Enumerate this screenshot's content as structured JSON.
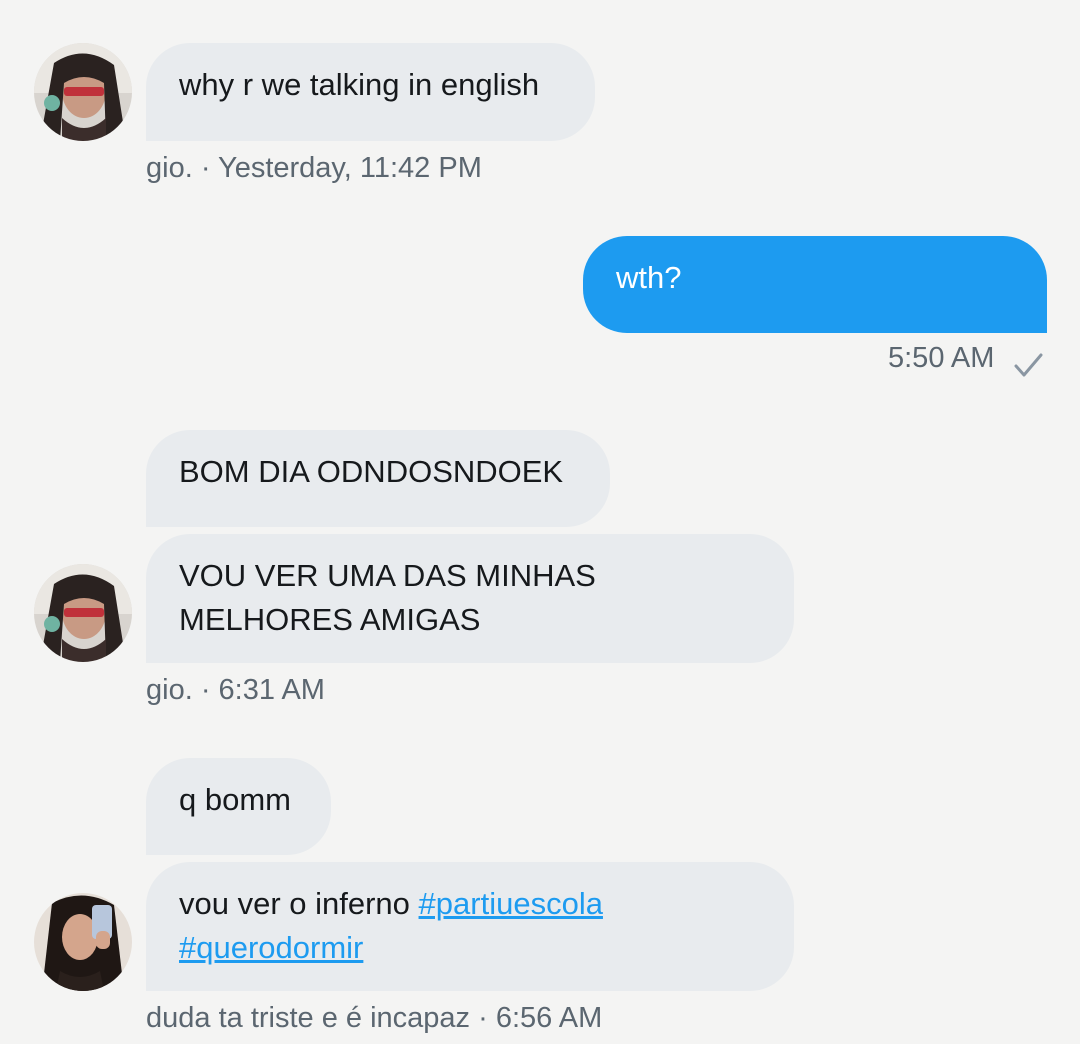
{
  "conversation": {
    "group1": {
      "messages": [
        "why r we talking in english"
      ],
      "sender": "gio.",
      "time": "Yesterday, 11:42 PM"
    },
    "group2": {
      "messages": [
        "wth?"
      ],
      "time": "5:50 AM",
      "status_icon": "checkmark-icon"
    },
    "group3": {
      "messages": [
        "BOM DIA ODNDOSNDOEK",
        "VOU VER UMA DAS MINHAS",
        "MELHORES AMIGAS"
      ],
      "sender": "gio.",
      "time": "6:31 AM"
    },
    "group4": {
      "messages": [
        "q bomm",
        "vou ver o inferno",
        "#partiuescola",
        "#querodormir"
      ],
      "sender": "duda ta triste e é incapaz",
      "time": "6:56 AM"
    }
  },
  "colors": {
    "background": "#f4f4f3",
    "received_bubble": "#e8ebee",
    "sent_bubble": "#1d9bf0",
    "hashtag": "#1d9bf0",
    "meta_text": "#5b6670"
  }
}
